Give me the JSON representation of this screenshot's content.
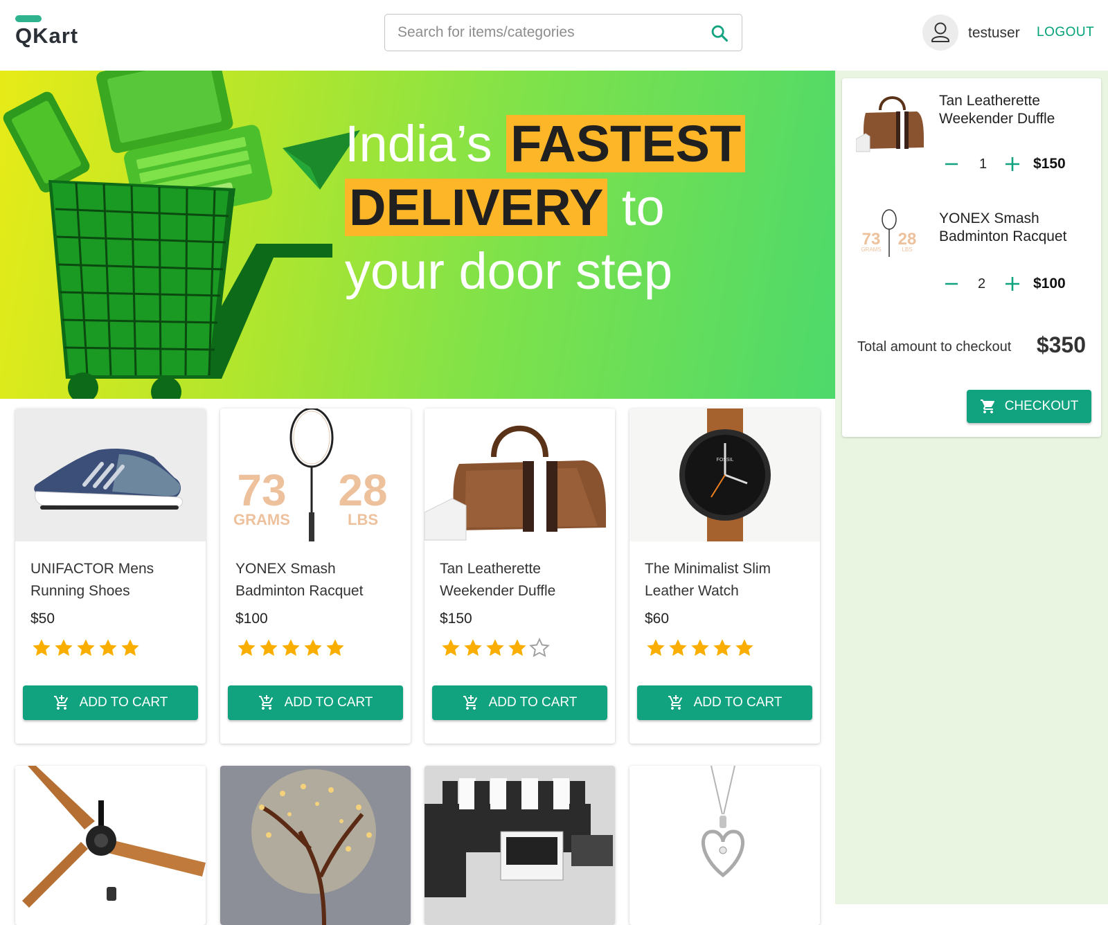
{
  "brand": {
    "name": "QKart",
    "accent": "#11a37f"
  },
  "search": {
    "placeholder": "Search for items/categories",
    "value": ""
  },
  "user": {
    "name": "testuser",
    "logout_label": "LOGOUT"
  },
  "hero": {
    "line1_plain": "India’s",
    "line1_highlight": "FASTEST",
    "line2_highlight": "DELIVERY",
    "line2_plain": "to",
    "line3": "your door step"
  },
  "products": [
    {
      "name": "UNIFACTOR Mens Running Shoes",
      "price": "$50",
      "rating": 5,
      "button": "ADD TO CART",
      "image": "shoe"
    },
    {
      "name": "YONEX Smash Badminton Racquet",
      "price": "$100",
      "rating": 5,
      "button": "ADD TO CART",
      "image": "racquet"
    },
    {
      "name": "Tan Leatherette Weekender Duffle",
      "price": "$150",
      "rating": 4,
      "button": "ADD TO CART",
      "image": "duffle"
    },
    {
      "name": "The Minimalist Slim Leather Watch",
      "price": "$60",
      "rating": 5,
      "button": "ADD TO CART",
      "image": "watch"
    }
  ],
  "products_row2": [
    {
      "image": "ceiling-fan"
    },
    {
      "image": "tree-lamp"
    },
    {
      "image": "sofa-set"
    },
    {
      "image": "heart-pendant"
    }
  ],
  "cart": {
    "items": [
      {
        "name": "Tan Leatherette Weekender Duffle",
        "qty": "1",
        "price": "$150",
        "image": "duffle"
      },
      {
        "name": "YONEX Smash Badminton Racquet",
        "qty": "2",
        "price": "$100",
        "image": "racquet"
      }
    ],
    "total_label": "Total amount to checkout",
    "total": "$350",
    "checkout_label": "CHECKOUT"
  },
  "racquet_image_text": {
    "left_num": "73",
    "left_unit": "GRAMS",
    "right_num": "28",
    "right_unit": "LBS"
  },
  "watch_brand": "FOSSIL"
}
